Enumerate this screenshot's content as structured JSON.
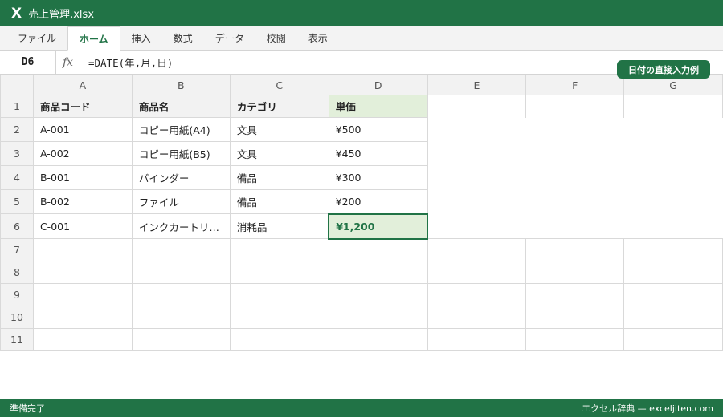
{
  "titlebar": {
    "logo": "X",
    "filename": "売上管理.xlsx"
  },
  "ribbon": {
    "tabs": [
      "ファイル",
      "ホーム",
      "挿入",
      "数式",
      "データ",
      "校閲",
      "表示"
    ],
    "active_index": 1
  },
  "formula_bar": {
    "cell_ref": "D6",
    "fx": "fx",
    "formula": "=DATE(年,月,日)"
  },
  "tag": "日付の直接入力例",
  "sheet": {
    "columns": [
      "A",
      "B",
      "C",
      "D",
      "E",
      "F",
      "G"
    ],
    "rows": [
      [
        "1",
        "商品コード",
        "商品名",
        "カテゴリ",
        "単価",
        "",
        "",
        ""
      ],
      [
        "2",
        "A-001",
        "コピー用紙(A4)",
        "文具",
        "¥500",
        "",
        "",
        ""
      ],
      [
        "3",
        "A-002",
        "コピー用紙(B5)",
        "文具",
        "¥450",
        "",
        "",
        ""
      ],
      [
        "4",
        "B-001",
        "バインダー",
        "備品",
        "¥300",
        "",
        "",
        ""
      ],
      [
        "5",
        "B-002",
        "ファイル",
        "備品",
        "¥200",
        "",
        "",
        ""
      ],
      [
        "6",
        "C-001",
        "インクカートリ…",
        "消耗品",
        "¥1,200",
        "",
        "",
        ""
      ],
      [
        "7",
        "",
        "",
        "",
        "",
        "",
        "",
        ""
      ],
      [
        "8",
        "",
        "",
        "",
        "",
        "",
        "",
        ""
      ],
      [
        "9",
        "",
        "",
        "",
        "",
        "",
        "",
        ""
      ],
      [
        "10",
        "",
        "",
        "",
        "",
        "",
        "",
        ""
      ],
      [
        "11",
        "",
        "",
        "",
        "",
        "",
        "",
        ""
      ]
    ],
    "active_cell": {
      "row": 6,
      "col": "D"
    }
  },
  "status": {
    "left": "準備完了",
    "right": "エクセル辞典 — exceljiten.com"
  },
  "colors": {
    "accent": "#217346",
    "selection_fill": "#e2efda",
    "header_fill": "#f2f2f2"
  }
}
